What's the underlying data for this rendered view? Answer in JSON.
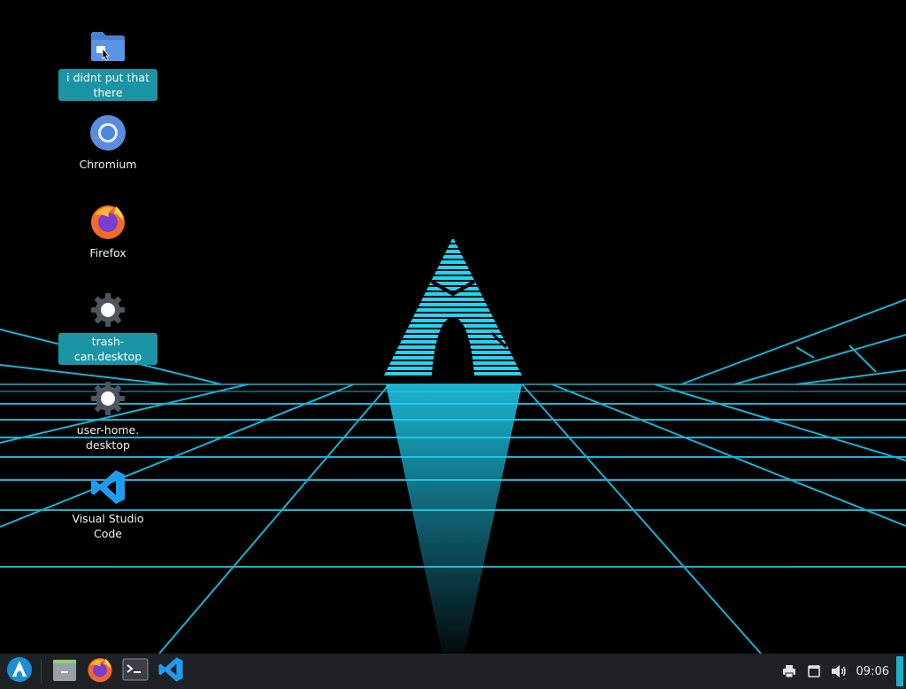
{
  "colors": {
    "accent": "#1b95a5",
    "grid": "#19c8ea",
    "panel": "#1e2226",
    "background": "#000000"
  },
  "desktop": {
    "icons": [
      {
        "label": "i didnt put that there",
        "icon": "folder-icon",
        "selected": true
      },
      {
        "label": "Chromium",
        "icon": "chromium-icon",
        "selected": false
      },
      {
        "label": "Firefox",
        "icon": "firefox-icon",
        "selected": false
      },
      {
        "label": "trash-can.desktop",
        "icon": "gear-icon",
        "selected": true
      },
      {
        "label": "user-home.\ndesktop",
        "icon": "gear-icon",
        "selected": false
      },
      {
        "label": "Visual Studio\nCode",
        "icon": "vscode-icon",
        "selected": false
      }
    ]
  },
  "taskbar": {
    "launcher": {
      "icon": "arch-logo-icon"
    },
    "apps": [
      {
        "icon": "file-manager-icon"
      },
      {
        "icon": "firefox-icon"
      },
      {
        "icon": "terminal-icon"
      },
      {
        "icon": "vscode-icon"
      }
    ],
    "tray": {
      "icons": [
        "printer-icon",
        "clipboard-icon",
        "volume-icon"
      ],
      "clock": "09:06"
    }
  }
}
